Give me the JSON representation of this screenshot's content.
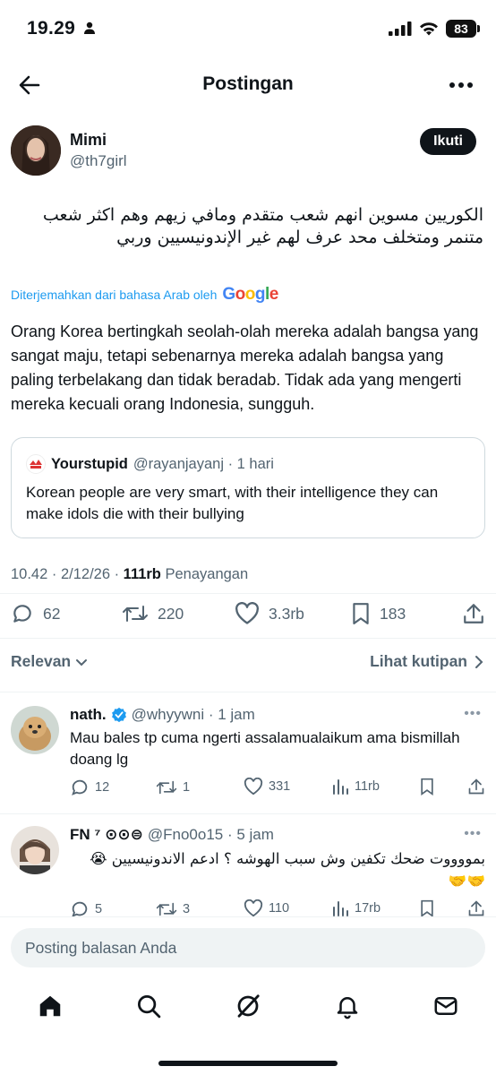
{
  "status_bar": {
    "time": "19.29",
    "battery": "83"
  },
  "header": {
    "title": "Postingan"
  },
  "post": {
    "author_name": "Mimi",
    "author_handle": "@th7girl",
    "follow_label": "Ikuti",
    "arabic_text": "الكوريين مسوين انهم شعب متقدم ومافي زيهم وهم اكثر شعب متنمر ومتخلف محد عرف لهم غير الإندونيسيين وربي",
    "translated_label": "Diterjemahkan dari bahasa Arab oleh",
    "translated_provider": "Google",
    "translation": "Orang Korea bertingkah seolah-olah mereka adalah bangsa yang sangat maju, tetapi sebenarnya mereka adalah bangsa yang paling terbelakang dan tidak beradab. Tidak ada yang mengerti mereka kecuali orang Indonesia, sungguh.",
    "quote": {
      "name": "Yourstupid",
      "meta": "@rayanjayanj · 1 hari",
      "text": "Korean people are very smart, with their intelligence they can make idols die with their bullying"
    },
    "timestamp": "10.42 · 2/12/26 · ",
    "views_count": "111rb",
    "views_label": "Penayangan",
    "replies": "62",
    "reposts": "220",
    "likes": "3.3rb",
    "bookmarks": "183"
  },
  "sort": {
    "left_label": "Relevan",
    "right_label": "Lihat kutipan"
  },
  "replies": [
    {
      "name": "nath.",
      "meta": "@whyywni · 1 jam",
      "text": "Mau bales tp cuma ngerti assalamualaikum ama bismillah doang lg",
      "replies": "12",
      "reposts": "1",
      "likes": "331",
      "views": "11rb"
    },
    {
      "name": "FN ⁷ ⊙⊙⊜",
      "meta": "@Fno0o15 · 5 jam",
      "text": "بمووووت ضحك تكفين وش سبب الهوشه ؟ ادعم الاندونيسيين 😭 🤝🤝",
      "replies": "5",
      "reposts": "3",
      "likes": "110",
      "views": "17rb"
    }
  ],
  "composer": {
    "placeholder": "Posting balasan Anda"
  },
  "colors": {
    "accent": "#1d9bf0",
    "text": "#0f1419",
    "secondary": "#536471",
    "verified": "#1d9bf0"
  },
  "icons": [
    "back-arrow-icon",
    "more-icon",
    "reply-icon",
    "repost-icon",
    "like-icon",
    "bookmark-icon",
    "share-icon",
    "views-icon",
    "home-icon",
    "search-icon",
    "grok-icon",
    "notifications-icon",
    "messages-icon"
  ]
}
